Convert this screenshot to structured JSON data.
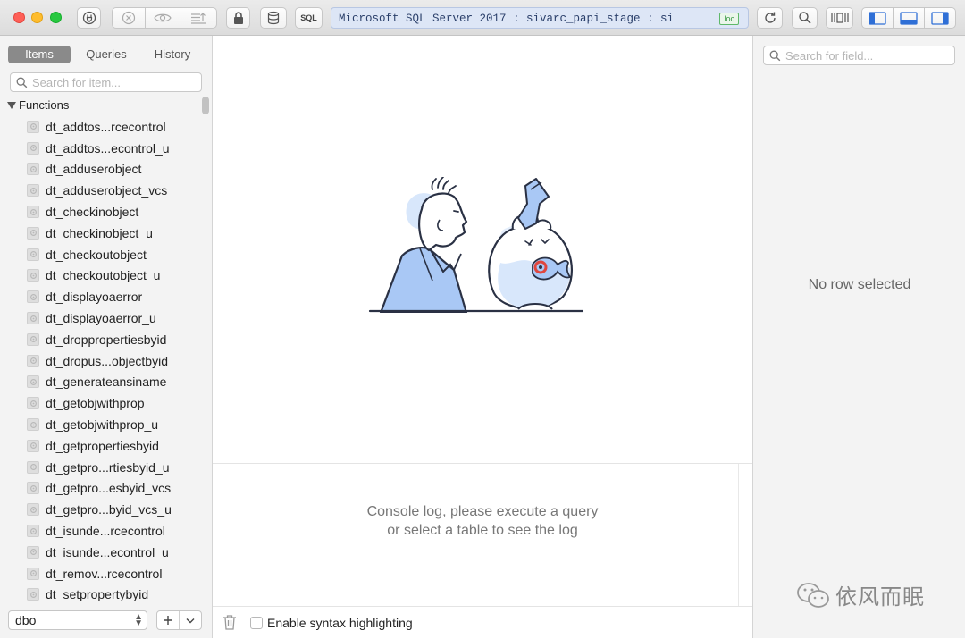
{
  "toolbar": {
    "connection": "Microsoft SQL Server 2017 : sivarc_papi_stage : si",
    "connection_badge": "loc",
    "sql_label": "SQL"
  },
  "sidebar": {
    "tabs": [
      {
        "label": "Items",
        "active": true
      },
      {
        "label": "Queries",
        "active": false
      },
      {
        "label": "History",
        "active": false
      }
    ],
    "search_placeholder": "Search for item...",
    "group_label": "Functions",
    "items": [
      "dt_addtos...rcecontrol",
      "dt_addtos...econtrol_u",
      "dt_adduserobject",
      "dt_adduserobject_vcs",
      "dt_checkinobject",
      "dt_checkinobject_u",
      "dt_checkoutobject",
      "dt_checkoutobject_u",
      "dt_displayoaerror",
      "dt_displayoaerror_u",
      "dt_droppropertiesbyid",
      "dt_dropus...objectbyid",
      "dt_generateansiname",
      "dt_getobjwithprop",
      "dt_getobjwithprop_u",
      "dt_getpropertiesbyid",
      "dt_getpro...rtiesbyid_u",
      "dt_getpro...esbyid_vcs",
      "dt_getpro...byid_vcs_u",
      "dt_isunde...rcecontrol",
      "dt_isunde...econtrol_u",
      "dt_remov...rcecontrol",
      "dt_setpropertybyid"
    ],
    "schema": "dbo"
  },
  "main": {
    "console_line1": "Console log, please execute a query",
    "console_line2": "or select a table to see the log",
    "syntax_label": "Enable syntax highlighting"
  },
  "right": {
    "search_placeholder": "Search for field...",
    "empty_text": "No row selected"
  },
  "watermark": {
    "text": "依风而眠"
  },
  "colors": {
    "connection_bg": "#dde6f6",
    "accent_blue": "#2f6fd6",
    "sidebar_bg": "#f3f3f3",
    "active_tab": "#8a8a8a",
    "illustration_blue": "#a9c8f5"
  }
}
